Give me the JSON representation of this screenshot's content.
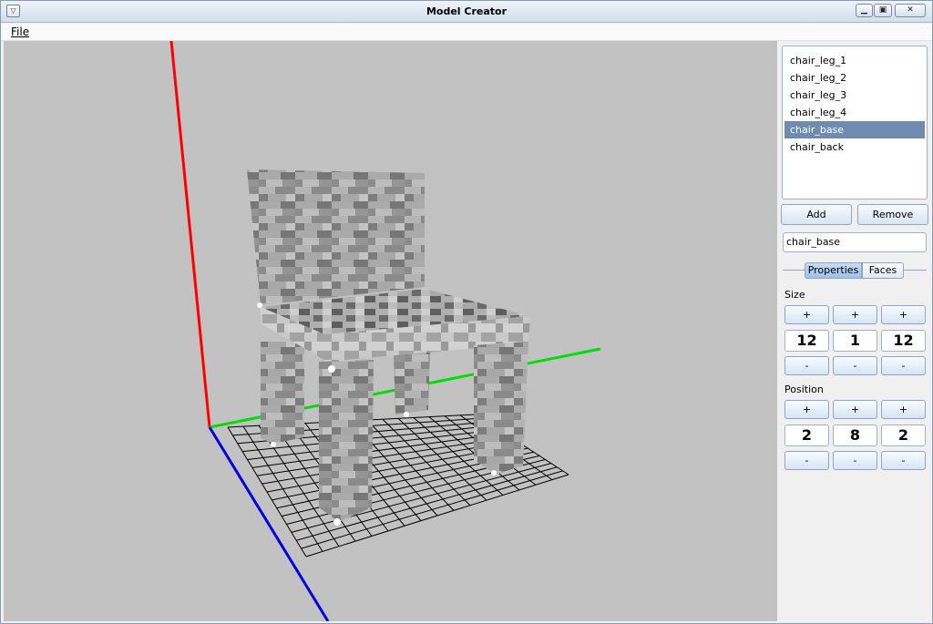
{
  "window": {
    "title": "Model Creator",
    "minimize_glyph": "▁",
    "maximize_glyph": "▣",
    "close_glyph": "✕",
    "menu_glyph": "▽"
  },
  "menu": {
    "file_label": "File"
  },
  "viewport": {
    "axis_colors": {
      "x": "#ff0000",
      "y": "#00dd00",
      "z": "#0000dd"
    },
    "background": "#c2c2c2",
    "floor_grid": "16x16 lines"
  },
  "parts": {
    "items": [
      "chair_leg_1",
      "chair_leg_2",
      "chair_leg_3",
      "chair_leg_4",
      "chair_base",
      "chair_back"
    ],
    "selected": "chair_base"
  },
  "buttons": {
    "add": "Add",
    "remove": "Remove"
  },
  "name_field_value": "chair_base",
  "tabs": {
    "properties": "Properties",
    "faces": "Faces",
    "active": "Properties"
  },
  "size": {
    "label": "Size",
    "x": "12",
    "y": "1",
    "z": "12"
  },
  "position": {
    "label": "Position",
    "x": "2",
    "y": "8",
    "z": "2"
  },
  "increment_label": "+",
  "decrement_label": "-",
  "colors": {
    "selection": "#6f8bb0",
    "button_border": "#8fa5c2"
  }
}
